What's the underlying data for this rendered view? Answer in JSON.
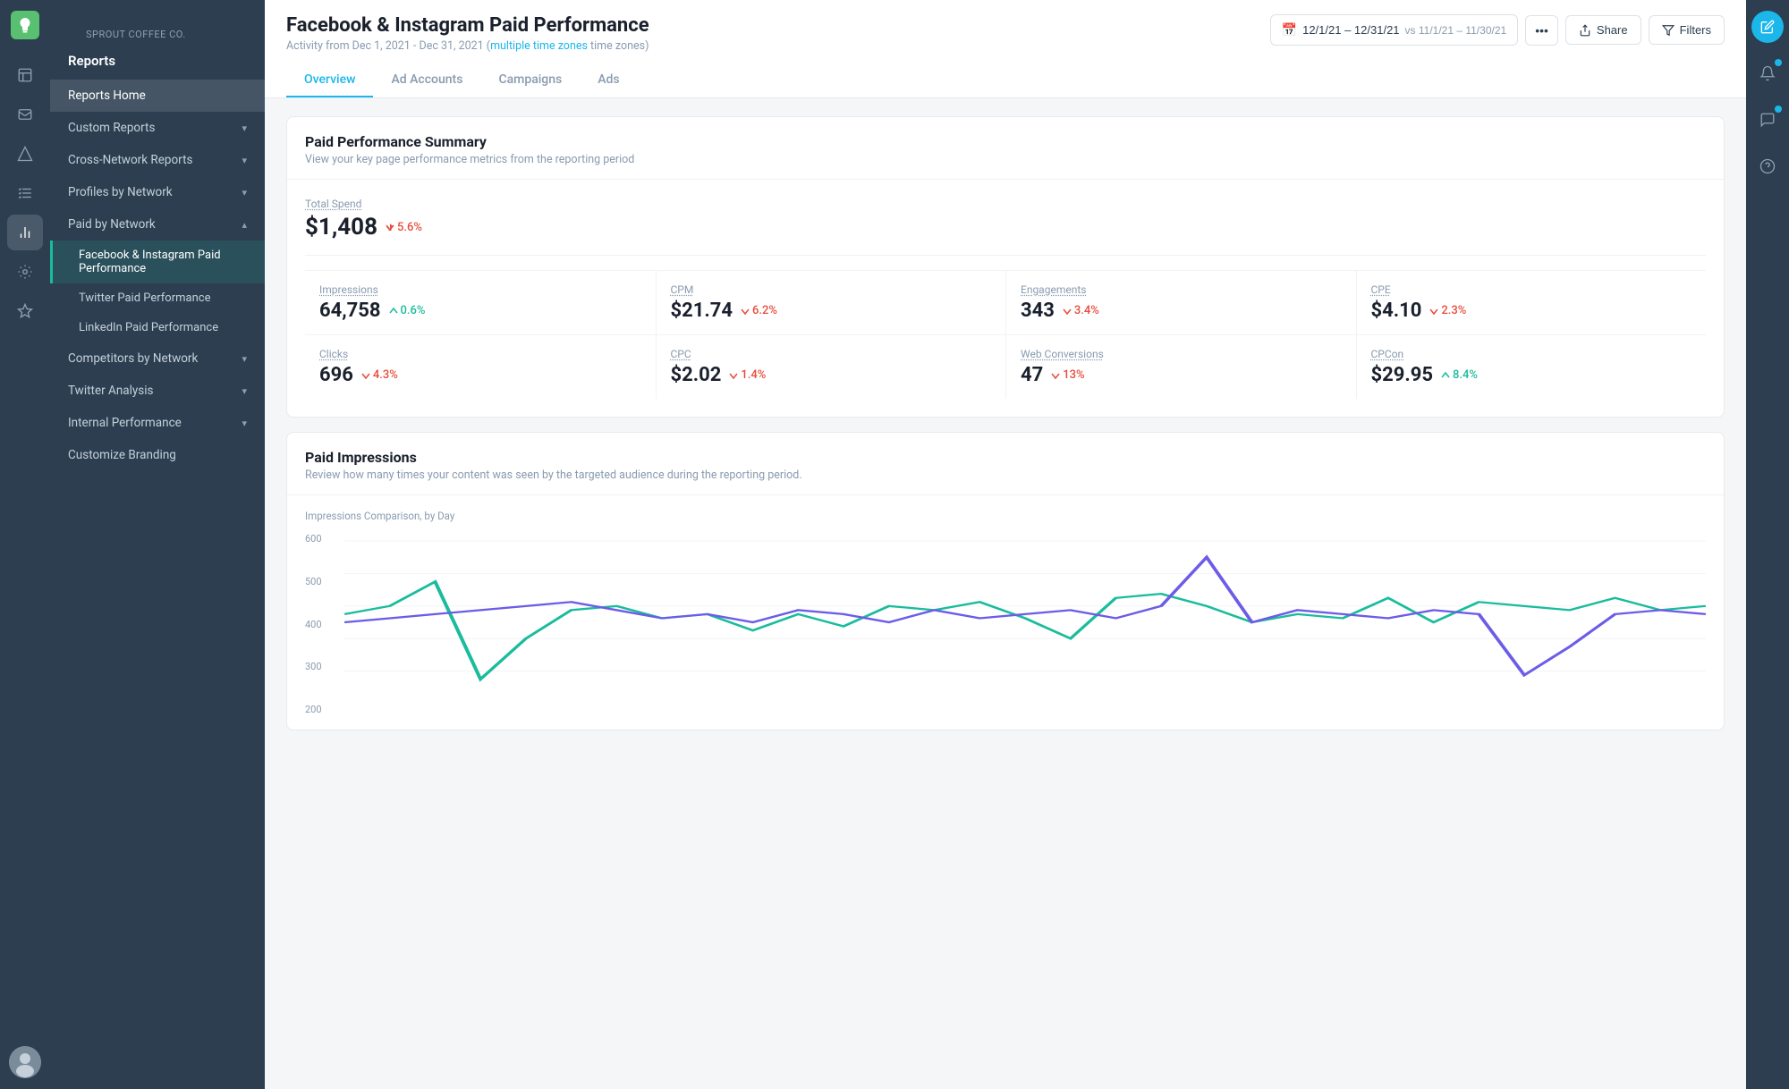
{
  "brand": {
    "company": "Sprout Coffee Co.",
    "app": "Reports"
  },
  "sidebar": {
    "items": [
      {
        "id": "reports-home",
        "label": "Reports Home",
        "active": true,
        "indent": 0
      },
      {
        "id": "custom-reports",
        "label": "Custom Reports",
        "hasChevron": true,
        "indent": 0
      },
      {
        "id": "cross-network-reports",
        "label": "Cross-Network Reports",
        "hasChevron": true,
        "indent": 0
      },
      {
        "id": "profiles-by-network",
        "label": "Profiles by Network",
        "hasChevron": true,
        "indent": 0
      },
      {
        "id": "paid-by-network",
        "label": "Paid by Network",
        "hasChevron": true,
        "expanded": true,
        "indent": 0
      },
      {
        "id": "fb-ig-paid",
        "label": "Facebook & Instagram Paid Performance",
        "isSubItem": true,
        "active": true
      },
      {
        "id": "twitter-paid",
        "label": "Twitter Paid Performance",
        "isSubItem": true
      },
      {
        "id": "linkedin-paid",
        "label": "LinkedIn Paid Performance",
        "isSubItem": true
      },
      {
        "id": "competitors-by-network",
        "label": "Competitors by Network",
        "hasChevron": true,
        "indent": 0
      },
      {
        "id": "twitter-analysis",
        "label": "Twitter Analysis",
        "hasChevron": true,
        "indent": 0
      },
      {
        "id": "internal-performance",
        "label": "Internal Performance",
        "hasChevron": true,
        "indent": 0
      },
      {
        "id": "customize-branding",
        "label": "Customize Branding",
        "indent": 0
      }
    ]
  },
  "header": {
    "title": "Facebook & Instagram Paid Performance",
    "subtitle": "Activity from Dec 1, 2021 - Dec 31, 2021",
    "timezone": "multiple time zones",
    "dateRange": "12/1/21 – 12/31/21",
    "compareRange": "vs 11/1/21 – 11/30/21",
    "shareLabel": "Share",
    "filtersLabel": "Filters"
  },
  "tabs": [
    {
      "id": "overview",
      "label": "Overview",
      "active": true
    },
    {
      "id": "ad-accounts",
      "label": "Ad Accounts"
    },
    {
      "id": "campaigns",
      "label": "Campaigns"
    },
    {
      "id": "ads",
      "label": "Ads"
    }
  ],
  "summary": {
    "title": "Paid Performance Summary",
    "subtitle": "View your key page performance metrics from the reporting period",
    "totalSpend": {
      "label": "Total Spend",
      "value": "$1,408",
      "change": "5.6%",
      "direction": "down"
    },
    "metrics": [
      {
        "id": "impressions",
        "label": "Impressions",
        "value": "64,758",
        "change": "0.6%",
        "direction": "up-teal"
      },
      {
        "id": "cpm",
        "label": "CPM",
        "value": "$21.74",
        "change": "6.2%",
        "direction": "down"
      },
      {
        "id": "engagements",
        "label": "Engagements",
        "value": "343",
        "change": "3.4%",
        "direction": "down"
      },
      {
        "id": "cpe",
        "label": "CPE",
        "value": "$4.10",
        "change": "2.3%",
        "direction": "down"
      },
      {
        "id": "clicks",
        "label": "Clicks",
        "value": "696",
        "change": "4.3%",
        "direction": "down"
      },
      {
        "id": "cpc",
        "label": "CPC",
        "value": "$2.02",
        "change": "1.4%",
        "direction": "down"
      },
      {
        "id": "web-conversions",
        "label": "Web Conversions",
        "value": "47",
        "change": "13%",
        "direction": "down"
      },
      {
        "id": "cpcon",
        "label": "CPCon",
        "value": "$29.95",
        "change": "8.4%",
        "direction": "up-teal"
      }
    ]
  },
  "impressions": {
    "title": "Paid Impressions",
    "subtitle": "Review how many times your content was seen by the targeted audience during the reporting period.",
    "chartLabel": "Impressions Comparison, by Day",
    "yAxis": [
      "600",
      "500",
      "400",
      "300",
      "200"
    ],
    "colors": {
      "line1": "#1abc9c",
      "line2": "#6c5ce7"
    }
  },
  "icons": {
    "calendar": "📅",
    "share": "↑",
    "filter": "⊟",
    "chevronDown": "▾",
    "chevronRight": "▸",
    "compose": "✎",
    "bell": "🔔",
    "comment": "💬",
    "help": "?",
    "reports": "📊",
    "down_arrow": "↘",
    "up_arrow": "↗"
  },
  "colors": {
    "sidebar_bg": "#2c3e50",
    "active_item": "#1a3347",
    "accent": "#1bb7ea",
    "tab_active": "#1bb7ea",
    "up": "#1abc9c",
    "down": "#e74c3c",
    "teal": "#1abc9c"
  }
}
